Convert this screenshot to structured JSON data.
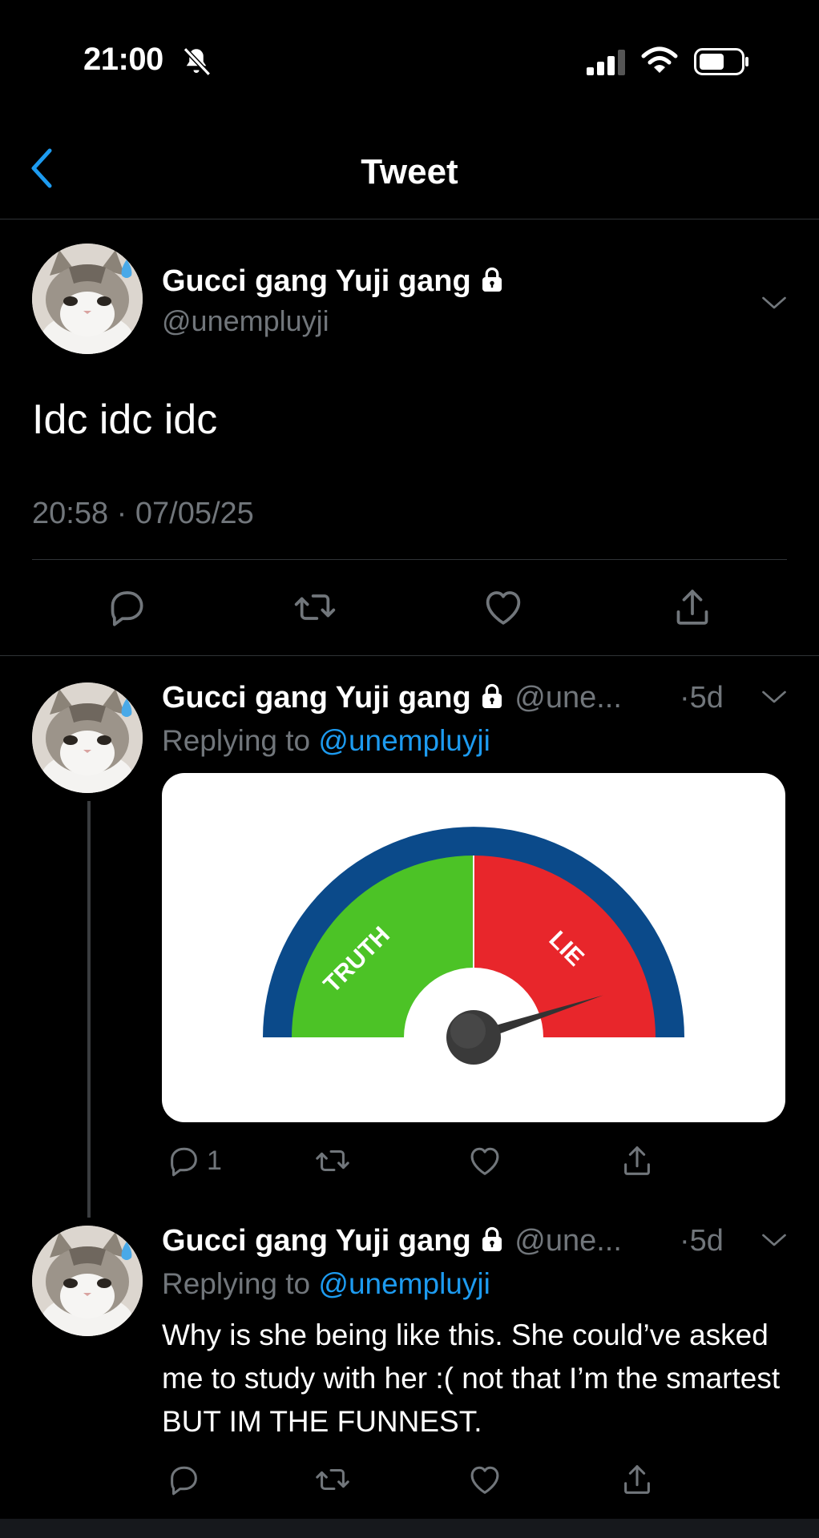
{
  "status_bar": {
    "time": "21:00"
  },
  "nav": {
    "title": "Tweet"
  },
  "main_tweet": {
    "display_name": "Gucci gang Yuji gang",
    "handle": "@unempluyji",
    "text": "Idc idc idc",
    "timestamp": "20:58 · 07/05/25"
  },
  "replies": [
    {
      "display_name": "Gucci gang Yuji gang",
      "handle_truncated": "@une...",
      "time": "·5d",
      "replying_prefix": "Replying to ",
      "replying_to": "@unempluyji",
      "media": {
        "left_label": "TRUTH",
        "right_label": "LIE",
        "left_color": "#4cc326",
        "right_color": "#e8262b",
        "rim_color": "#0b4a8a",
        "needle_level": 0.9
      },
      "reply_count": "1"
    },
    {
      "display_name": "Gucci gang Yuji gang",
      "handle_truncated": "@une...",
      "time": "·5d",
      "replying_prefix": "Replying to ",
      "replying_to": "@unempluyji",
      "text": "Why is she being like this. She could’ve asked me to study with her :( not that I’m the smartest BUT IM THE FUNNEST."
    }
  ],
  "icons": [
    "back-icon",
    "lock-icon",
    "chevron-down-icon",
    "reply-icon",
    "retweet-icon",
    "like-icon",
    "share-icon",
    "mute-icon",
    "signal-icon",
    "wifi-icon",
    "battery-icon"
  ],
  "colors": {
    "background": "#000000",
    "accent": "#1d9bf0",
    "muted_text": "#71767b",
    "divider": "#2f3336"
  }
}
